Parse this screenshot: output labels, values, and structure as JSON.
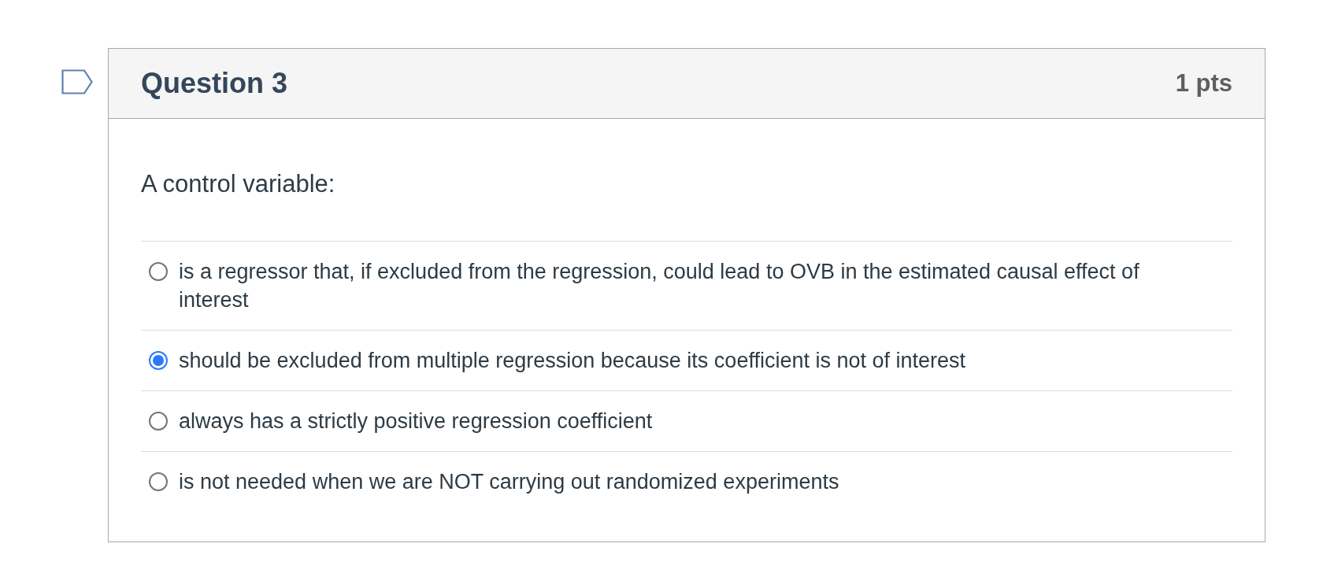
{
  "question": {
    "title": "Question 3",
    "points": "1 pts",
    "prompt": "A control variable:"
  },
  "answers": [
    {
      "label": "is a regressor that, if excluded from the regression, could lead to OVB in the estimated causal effect of interest",
      "selected": false
    },
    {
      "label": "should be excluded from multiple regression because its coefficient is not of interest",
      "selected": true
    },
    {
      "label": "always has a strictly positive regression coefficient",
      "selected": false
    },
    {
      "label": "is not needed when we are NOT carrying out randomized experiments",
      "selected": false
    }
  ]
}
